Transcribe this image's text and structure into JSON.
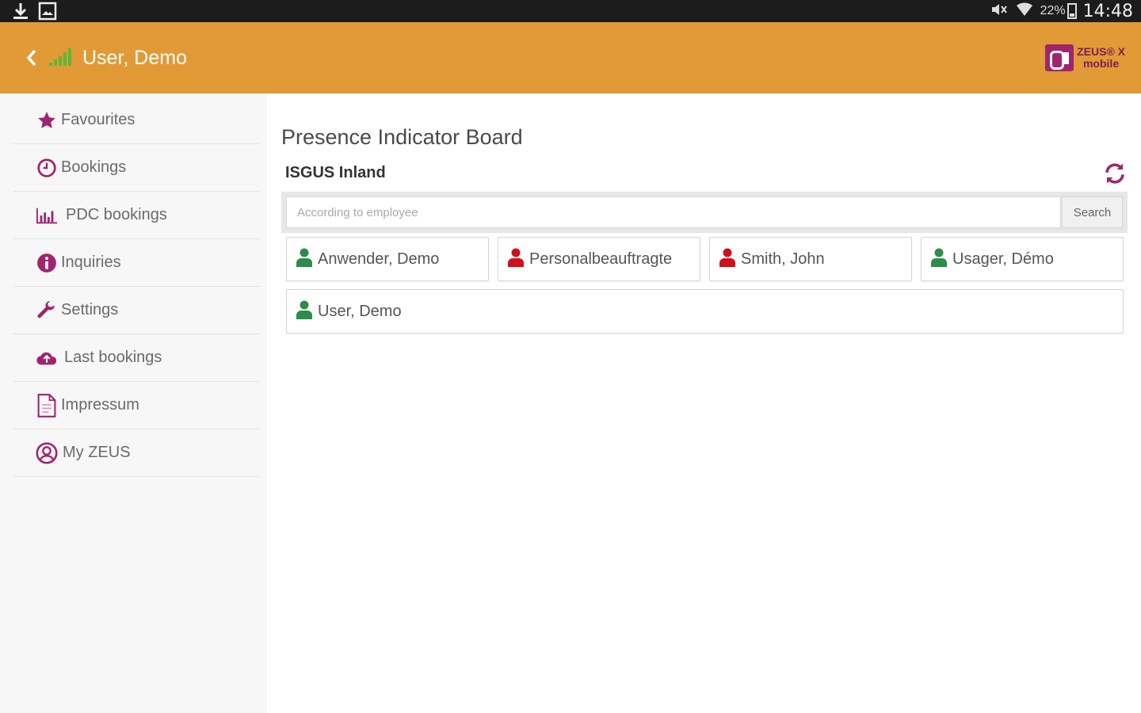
{
  "status_bar": {
    "time": "14:48",
    "battery": "22%"
  },
  "app_bar": {
    "title": "User, Demo",
    "logo_line1": "ZEUS® X",
    "logo_line2": "mobile"
  },
  "sidebar": {
    "items": [
      {
        "label": "Favourites",
        "icon": "star-icon"
      },
      {
        "label": "Bookings",
        "icon": "clock-icon"
      },
      {
        "label": "PDC bookings",
        "icon": "bar-chart-icon"
      },
      {
        "label": "Inquiries",
        "icon": "info-icon"
      },
      {
        "label": "Settings",
        "icon": "wrench-icon"
      },
      {
        "label": "Last bookings",
        "icon": "cloud-upload-icon"
      },
      {
        "label": "Impressum",
        "icon": "document-icon"
      },
      {
        "label": "My ZEUS",
        "icon": "user-circle-icon"
      }
    ]
  },
  "main": {
    "title": "Presence Indicator Board",
    "section": "ISGUS Inland",
    "search": {
      "placeholder": "According to employee",
      "button": "Search"
    },
    "employees": [
      {
        "name": "Anwender, Demo",
        "status": "present",
        "color": "#2e8b4a"
      },
      {
        "name": "Personalbeauftragte",
        "status": "absent",
        "color": "#d0101a"
      },
      {
        "name": "Smith, John",
        "status": "absent",
        "color": "#d0101a"
      },
      {
        "name": "Usager, Démo",
        "status": "present",
        "color": "#2e8b4a"
      },
      {
        "name": "User, Demo",
        "status": "present",
        "color": "#2e8b4a"
      }
    ]
  },
  "colors": {
    "accent": "#e19a35",
    "icon_purple": "#a0246e",
    "present": "#2e8b4a",
    "absent": "#d0101a"
  }
}
